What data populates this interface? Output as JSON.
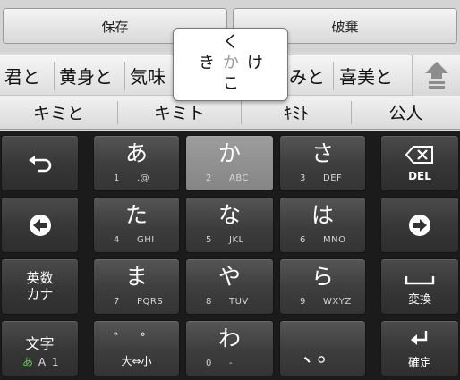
{
  "top_bar": {
    "save_label": "保存",
    "discard_label": "破棄"
  },
  "candidates_row1": [
    "君と",
    "黄身と",
    "気味",
    "みと",
    "喜美と"
  ],
  "candidates_row2": [
    "キミと",
    "キミト",
    "ｷﾐﾄ",
    "公人"
  ],
  "flick_popup": {
    "up": "く",
    "left": "き",
    "center": "か",
    "right": "け",
    "down": "こ"
  },
  "keys": {
    "a": {
      "kana": "あ",
      "num": "1",
      "sub": ".@"
    },
    "ka": {
      "kana": "か",
      "num": "2",
      "sub": "ABC"
    },
    "sa": {
      "kana": "さ",
      "num": "3",
      "sub": "DEF"
    },
    "ta": {
      "kana": "た",
      "num": "4",
      "sub": "GHI"
    },
    "na": {
      "kana": "な",
      "num": "5",
      "sub": "JKL"
    },
    "ha": {
      "kana": "は",
      "num": "6",
      "sub": "MNO"
    },
    "ma": {
      "kana": "ま",
      "num": "7",
      "sub": "PQRS"
    },
    "ya": {
      "kana": "や",
      "num": "8",
      "sub": "TUV"
    },
    "ra": {
      "kana": "ら",
      "num": "9",
      "sub": "WXYZ"
    },
    "wa": {
      "kana": "わ",
      "num": "0",
      "sub": "-"
    },
    "dakuten": {
      "top": "゛ ゜",
      "bottom": "大⇔小"
    },
    "punct": {
      "label": "、。"
    }
  },
  "fn_keys": {
    "del_label": "DEL",
    "eisu_line1": "英数",
    "eisu_line2": "カナ",
    "henkan_label": "変換",
    "moji_line1": "文字",
    "moji_mode_kana": "あ",
    "moji_mode_alpha": "A",
    "moji_mode_num": "1",
    "enter_label": "確定"
  },
  "icons": {
    "undo": "undo-arrow-icon",
    "left": "left-arrow-icon",
    "right": "right-arrow-icon",
    "backspace": "backspace-icon",
    "space": "space-icon",
    "enter": "enter-icon",
    "scroll": "scroll-up-icon"
  },
  "colors": {
    "keyboard_bg": "#1b1b1b",
    "key": "#3d3d3d",
    "pressed_key": "#8f8f8f",
    "mode_green": "#5bd44a"
  }
}
